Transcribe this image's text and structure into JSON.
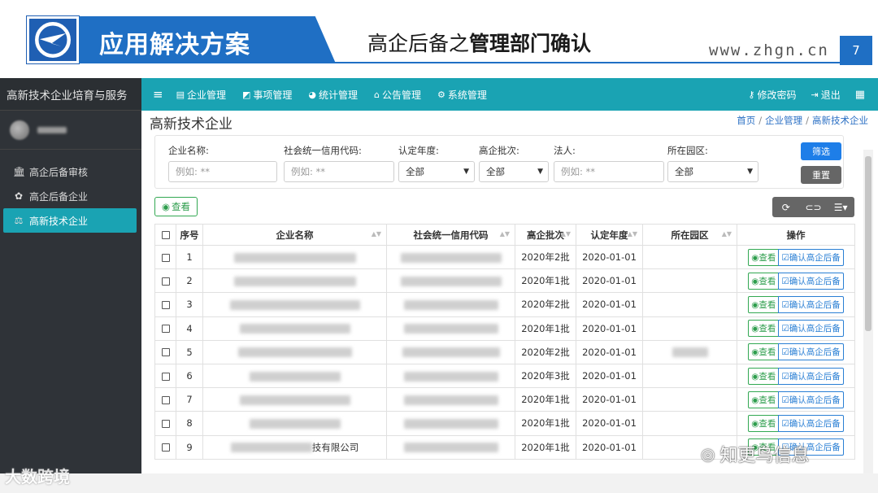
{
  "slide": {
    "title": "应用解决方案",
    "subtitle_prefix": "高企后备之",
    "subtitle_bold": "管理部门确认",
    "url": "www.zhgn.cn",
    "page_number": "7",
    "accent": "#1f6fc4"
  },
  "sidebar": {
    "app_title": "高新技术企业培育与服务",
    "items": [
      {
        "label": "高企后备审核",
        "icon": "bank-icon"
      },
      {
        "label": "高企后备企业",
        "icon": "leaf-icon"
      },
      {
        "label": "高新技术企业",
        "icon": "balance-scale-icon"
      }
    ]
  },
  "topnav": {
    "items": [
      {
        "label": "企业管理",
        "icon": "document-icon"
      },
      {
        "label": "事项管理",
        "icon": "area-chart-icon"
      },
      {
        "label": "统计管理",
        "icon": "pie-chart-icon"
      },
      {
        "label": "公告管理",
        "icon": "home-icon"
      },
      {
        "label": "系统管理",
        "icon": "gears-icon"
      }
    ],
    "change_password": "修改密码",
    "logout": "退出",
    "accent": "#1aa3b3"
  },
  "content": {
    "page_title": "高新技术企业",
    "breadcrumb": [
      "首页",
      "企业管理",
      "高新技术企业"
    ]
  },
  "filters": {
    "company_name": {
      "label": "企业名称:",
      "placeholder": "例如: **"
    },
    "credit_code": {
      "label": "社会统一信用代码:",
      "placeholder": "例如: **"
    },
    "year": {
      "label": "认定年度:",
      "value": "全部"
    },
    "batch": {
      "label": "高企批次:",
      "value": "全部"
    },
    "legal_person": {
      "label": "法人:",
      "placeholder": "例如: **"
    },
    "park": {
      "label": "所在园区:",
      "value": "全部"
    },
    "filter_button": "筛选",
    "reset_button": "重置"
  },
  "toolbar": {
    "view_label": "查看"
  },
  "table": {
    "headers": [
      "序号",
      "企业名称",
      "社会统一信用代码",
      "高企批次",
      "认定年度",
      "所在园区",
      "操作"
    ],
    "view_label": "查看",
    "confirm_label": "确认高企后备",
    "rows": [
      {
        "no": "1",
        "batch": "2020年2批",
        "year": "2020-01-01",
        "name_suffix": "",
        "code_suffix": "",
        "park": ""
      },
      {
        "no": "2",
        "batch": "2020年1批",
        "year": "2020-01-01",
        "name_suffix": "",
        "code_suffix": "",
        "park": ""
      },
      {
        "no": "3",
        "batch": "2020年2批",
        "year": "2020-01-01",
        "name_suffix": "",
        "code_suffix": "",
        "park": ""
      },
      {
        "no": "4",
        "batch": "2020年1批",
        "year": "2020-01-01",
        "name_suffix": "",
        "code_suffix": "",
        "park": ""
      },
      {
        "no": "5",
        "batch": "2020年2批",
        "year": "2020-01-01",
        "name_suffix": "",
        "code_suffix": "",
        "park": "blurred"
      },
      {
        "no": "6",
        "batch": "2020年3批",
        "year": "2020-01-01",
        "name_suffix": "",
        "code_suffix": "",
        "park": ""
      },
      {
        "no": "7",
        "batch": "2020年1批",
        "year": "2020-01-01",
        "name_suffix": "",
        "code_suffix": "",
        "park": ""
      },
      {
        "no": "8",
        "batch": "2020年1批",
        "year": "2020-01-01",
        "name_suffix": "",
        "code_suffix": "",
        "park": ""
      },
      {
        "no": "9",
        "batch": "2020年1批",
        "year": "2020-01-01",
        "name_suffix": "技有限公司",
        "code_suffix": "",
        "park": ""
      }
    ]
  },
  "watermarks": {
    "left": "大数跨境",
    "right": "知更鸟信息"
  }
}
